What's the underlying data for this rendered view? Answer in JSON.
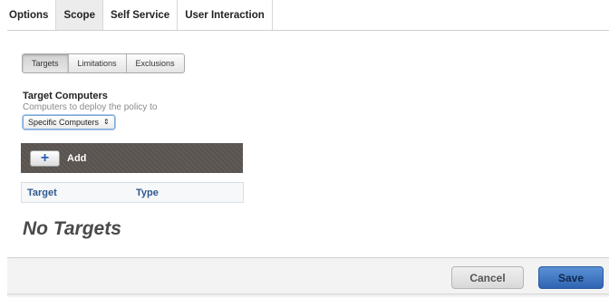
{
  "tabs": [
    {
      "label": "Options",
      "active": false
    },
    {
      "label": "Scope",
      "active": true
    },
    {
      "label": "Self Service",
      "active": false
    },
    {
      "label": "User Interaction",
      "active": false
    }
  ],
  "scope_tabs": [
    {
      "label": "Targets",
      "active": true
    },
    {
      "label": "Limitations",
      "active": false
    },
    {
      "label": "Exclusions",
      "active": false
    }
  ],
  "target_computers": {
    "title": "Target Computers",
    "subtitle": "Computers to deploy the policy to",
    "selected": "Specific Computers"
  },
  "add_bar": {
    "icon": "plus-icon",
    "label": "Add"
  },
  "table": {
    "columns": [
      "Target",
      "Type"
    ],
    "empty_text": "No Targets"
  },
  "footer": {
    "cancel_label": "Cancel",
    "save_label": "Save"
  },
  "colors": {
    "accent": "#2f64b3",
    "header_text": "#2d5a8e",
    "toolbar_bg": "#5b5652"
  }
}
